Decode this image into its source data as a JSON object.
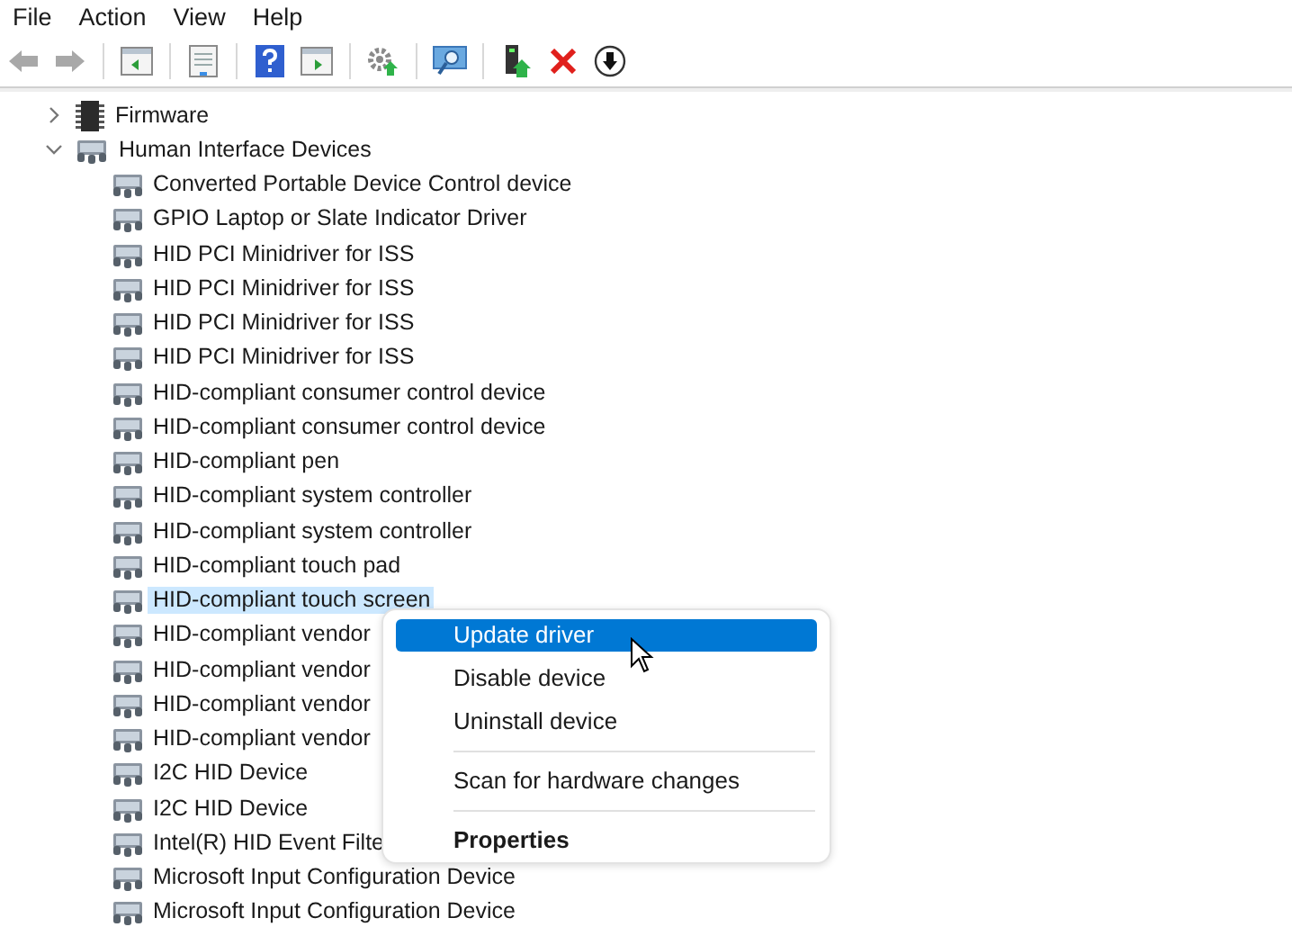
{
  "menu_bar": [
    "File",
    "Action",
    "View",
    "Help"
  ],
  "tree": [
    {
      "kind": "firmware",
      "label": "Firmware",
      "expanded": false,
      "selected": false
    },
    {
      "kind": "hid",
      "label": "Human Interface Devices",
      "expanded": true,
      "selected": false,
      "children": [
        {
          "label": "Converted Portable Device Control device",
          "selected": false
        },
        {
          "label": "GPIO Laptop or Slate Indicator Driver",
          "selected": false
        },
        {
          "label": "HID PCI Minidriver for ISS",
          "selected": false
        },
        {
          "label": "HID PCI Minidriver for ISS",
          "selected": false
        },
        {
          "label": "HID PCI Minidriver for ISS",
          "selected": false
        },
        {
          "label": "HID PCI Minidriver for ISS",
          "selected": false
        },
        {
          "label": "HID-compliant consumer control device",
          "selected": false
        },
        {
          "label": "HID-compliant consumer control device",
          "selected": false
        },
        {
          "label": "HID-compliant pen",
          "selected": false
        },
        {
          "label": "HID-compliant system controller",
          "selected": false
        },
        {
          "label": "HID-compliant system controller",
          "selected": false
        },
        {
          "label": "HID-compliant touch pad",
          "selected": false
        },
        {
          "label": "HID-compliant touch screen",
          "selected": true
        },
        {
          "label": "HID-compliant vendor",
          "selected": false
        },
        {
          "label": "HID-compliant vendor",
          "selected": false
        },
        {
          "label": "HID-compliant vendor",
          "selected": false
        },
        {
          "label": "HID-compliant vendor",
          "selected": false
        },
        {
          "label": "I2C HID Device",
          "selected": false
        },
        {
          "label": "I2C HID Device",
          "selected": false
        },
        {
          "label": "Intel(R) HID Event Filte",
          "selected": false
        },
        {
          "label": "Microsoft Input Configuration Device",
          "selected": false
        },
        {
          "label": "Microsoft Input Configuration Device",
          "selected": false
        }
      ]
    }
  ],
  "context_menu": [
    {
      "kind": "item",
      "label": "Update driver",
      "selected": true
    },
    {
      "kind": "item",
      "label": "Disable device",
      "selected": false
    },
    {
      "kind": "item",
      "label": "Uninstall device",
      "selected": false
    },
    {
      "kind": "separator"
    },
    {
      "kind": "item",
      "label": "Scan for hardware changes",
      "selected": false
    },
    {
      "kind": "separator"
    },
    {
      "kind": "default",
      "label": "Properties",
      "selected": false
    }
  ]
}
